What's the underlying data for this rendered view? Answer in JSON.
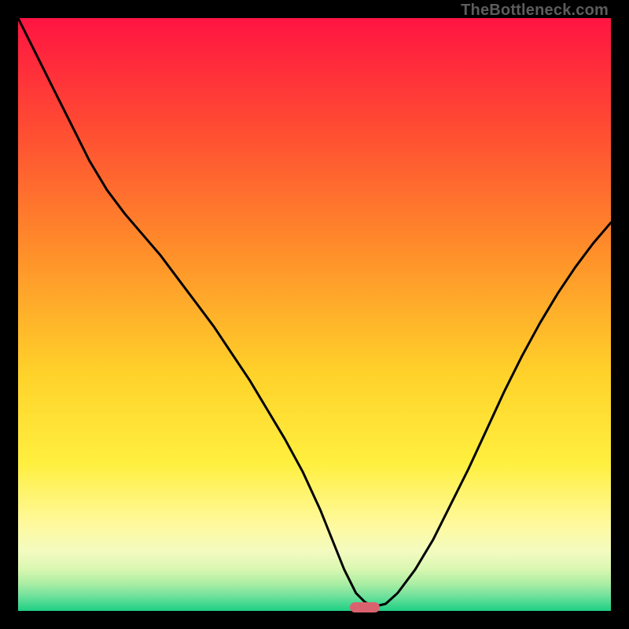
{
  "watermark": "TheBottleneck.com",
  "colors": {
    "gradient_top": "#ff1442",
    "gradient_upper_mid": "#ff8a2a",
    "gradient_mid": "#ffe22e",
    "gradient_lower1": "#fff99a",
    "gradient_lower2": "#d9f7b0",
    "gradient_lower3": "#7de3a4",
    "gradient_bottom": "#1ecf84",
    "curve": "#000000",
    "marker": "#d9626e",
    "frame": "#000000"
  },
  "chart_data": {
    "type": "line",
    "title": "",
    "xlabel": "",
    "ylabel": "",
    "xlim": [
      0,
      100
    ],
    "ylim": [
      0,
      100
    ],
    "series": [
      {
        "name": "bottleneck-curve",
        "x": [
          0,
          3,
          6,
          9,
          12,
          15,
          18,
          21,
          24,
          27,
          30,
          33,
          36,
          39,
          42,
          45,
          48,
          51,
          53,
          55,
          57,
          58.5,
          60,
          62,
          64,
          67,
          70,
          73,
          76,
          79,
          82,
          85,
          88,
          91,
          94,
          97,
          100
        ],
        "values": [
          100,
          94,
          88,
          82,
          76,
          71,
          67,
          63.5,
          60,
          56,
          52,
          48,
          43.5,
          39,
          34,
          29,
          23.5,
          17,
          12,
          7,
          3,
          1.5,
          0.7,
          1.2,
          3,
          7,
          12,
          18,
          24,
          30.5,
          37,
          43,
          48.5,
          53.5,
          58,
          62,
          65.5
        ]
      }
    ],
    "annotations": [
      {
        "name": "optimal-marker",
        "x_center": 58.5,
        "y": 0.7,
        "width_pct": 5
      }
    ]
  },
  "layout": {
    "image_size": 800,
    "frame_margin": 23,
    "plot_size": 754
  }
}
